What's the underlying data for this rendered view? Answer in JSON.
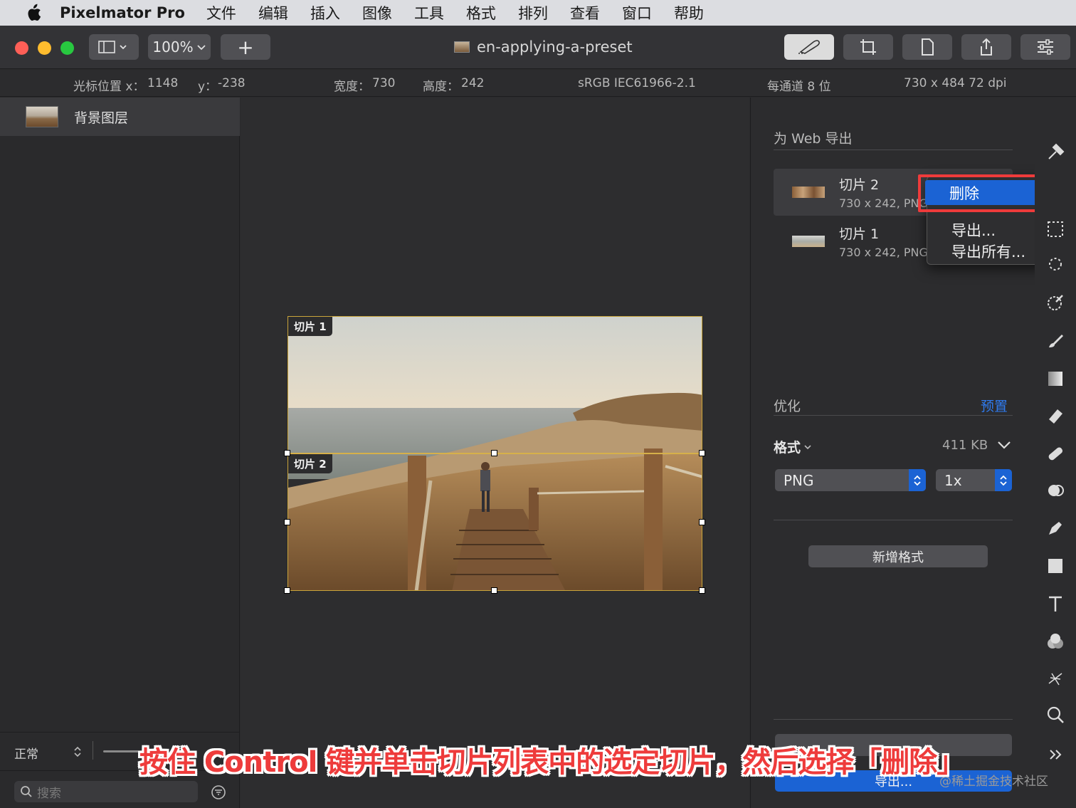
{
  "menubar": {
    "app_name": "Pixelmator Pro",
    "items": [
      "文件",
      "编辑",
      "插入",
      "图像",
      "工具",
      "格式",
      "排列",
      "查看",
      "窗口",
      "帮助"
    ]
  },
  "toolbar": {
    "zoom": "100%",
    "add_label": "+",
    "document_title": "en-applying-a-preset"
  },
  "infobar": {
    "cursor_x_label": "光标位置 x：",
    "cursor_x": "1148",
    "cursor_y_label": "y：",
    "cursor_y": "-238",
    "width_label": "宽度：",
    "width": "730",
    "height_label": "高度：",
    "height": "242",
    "color_profile": "sRGB IEC61966-2.1",
    "bit_depth": "每通道 8 位",
    "size_dpi": "730 x 484 72 dpi"
  },
  "layers": {
    "items": [
      {
        "name": "背景图层"
      }
    ],
    "blend_mode": "正常",
    "search_placeholder": "搜索"
  },
  "canvas": {
    "slices": [
      {
        "label": "切片 1"
      },
      {
        "label": "切片 2"
      }
    ]
  },
  "export_panel": {
    "title": "为 Web 导出",
    "slices": [
      {
        "name": "切片 2",
        "info": "730 x 242, PNG"
      },
      {
        "name": "切片 1",
        "info": "730 x 242, PNG"
      }
    ],
    "context_menu": {
      "delete": "删除",
      "export": "导出...",
      "export_all": "导出所有..."
    },
    "optimize_label": "优化",
    "preset_label": "预置",
    "format_label": "格式",
    "file_size": "411 KB",
    "format_value": "PNG",
    "scale_value": "1x",
    "add_format": "新增格式",
    "export_button": "导出..."
  },
  "caption": "按住 Control 键并单击切片列表中的选定切片，然后选择「删除」",
  "watermark": "@稀土掘金技术社区",
  "colors": {
    "accent_blue": "#1b63d4",
    "highlight_red": "#ee3b3b",
    "slice_yellow": "#d6b04a"
  }
}
